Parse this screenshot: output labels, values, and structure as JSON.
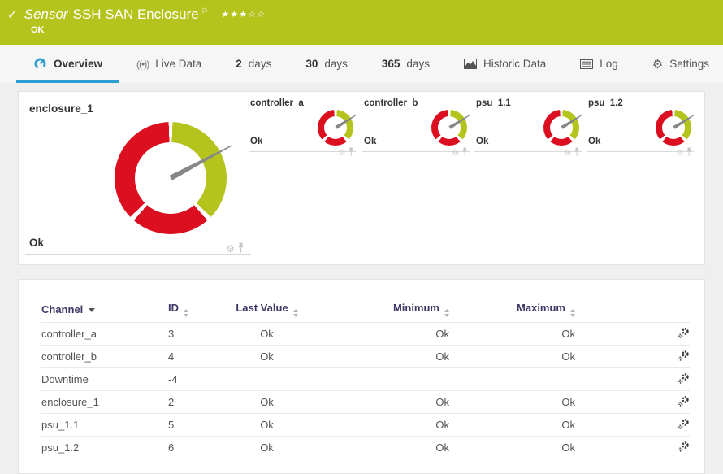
{
  "header": {
    "status_icon": "✓",
    "kind_label": "Sensor",
    "title": "SSH SAN Enclosure",
    "flag_icon": "⚐",
    "stars_filled": "★★★",
    "stars_empty": "☆☆",
    "status": "OK"
  },
  "tabs": [
    {
      "label": "Overview",
      "icon": "gauge-icon",
      "active": true
    },
    {
      "label": "Live Data",
      "icon": "live-data-icon"
    },
    {
      "num": "2",
      "label": "days"
    },
    {
      "num": "30",
      "label": "days"
    },
    {
      "num": "365",
      "label": "days"
    },
    {
      "label": "Historic Data",
      "icon": "chart-icon"
    },
    {
      "label": "Log",
      "icon": "log-icon"
    },
    {
      "label": "Settings",
      "icon": "gear-icon"
    }
  ],
  "gauges": {
    "primary": {
      "name": "enclosure_1",
      "status": "Ok"
    },
    "secondary": [
      {
        "name": "controller_a",
        "status": "Ok"
      },
      {
        "name": "controller_b",
        "status": "Ok"
      },
      {
        "name": "psu_1.1",
        "status": "Ok"
      },
      {
        "name": "psu_1.2",
        "status": "Ok"
      }
    ]
  },
  "colors": {
    "ok_green": "#b4c41d",
    "alarm_red": "#dc0f21",
    "accent_blue": "#2a9dd3"
  },
  "table": {
    "columns": [
      "Channel",
      "ID",
      "Last Value",
      "Minimum",
      "Maximum"
    ],
    "rows": [
      {
        "channel": "controller_a",
        "id": "3",
        "last": "Ok",
        "min": "Ok",
        "max": "Ok"
      },
      {
        "channel": "controller_b",
        "id": "4",
        "last": "Ok",
        "min": "Ok",
        "max": "Ok"
      },
      {
        "channel": "Downtime",
        "id": "-4",
        "last": "",
        "min": "",
        "max": ""
      },
      {
        "channel": "enclosure_1",
        "id": "2",
        "last": "Ok",
        "min": "Ok",
        "max": "Ok"
      },
      {
        "channel": "psu_1.1",
        "id": "5",
        "last": "Ok",
        "min": "Ok",
        "max": "Ok"
      },
      {
        "channel": "psu_1.2",
        "id": "6",
        "last": "Ok",
        "min": "Ok",
        "max": "Ok"
      }
    ]
  }
}
